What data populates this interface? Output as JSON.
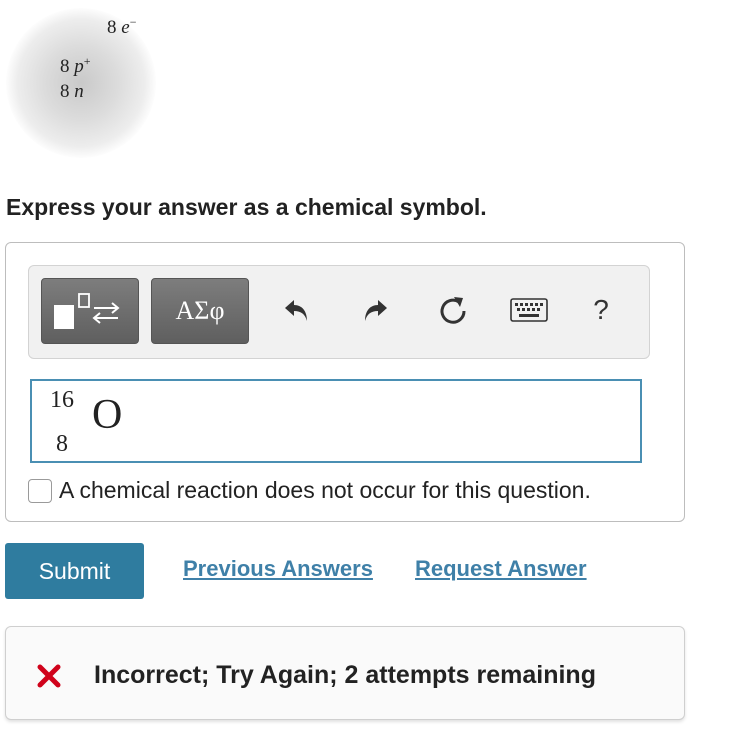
{
  "atom": {
    "electrons_count": "8",
    "electrons_symbol": "e",
    "electrons_charge": "−",
    "protons_count": "8",
    "protons_symbol": "p",
    "protons_charge": "+",
    "neutrons_count": "8",
    "neutrons_symbol": "n"
  },
  "prompt": "Express your answer as a chemical symbol.",
  "toolbar": {
    "greek_label": "ΑΣφ",
    "help_label": "?",
    "icons": [
      "templates-icon",
      "undo-icon",
      "redo-icon",
      "reset-icon",
      "keyboard-icon",
      "help-icon"
    ]
  },
  "answer": {
    "mass_number": "16",
    "atomic_number": "8",
    "symbol": "O"
  },
  "no_reaction_label": "A chemical reaction does not occur for this question.",
  "actions": {
    "submit_label": "Submit",
    "previous_answers_label": "Previous Answers",
    "request_answer_label": "Request Answer"
  },
  "feedback": {
    "text": "Incorrect; Try Again; 2 attempts remaining"
  },
  "colors": {
    "accent": "#2f7c9f",
    "link": "#3f80a8",
    "error": "#d0021b",
    "answer_border": "#4a8fb3"
  }
}
